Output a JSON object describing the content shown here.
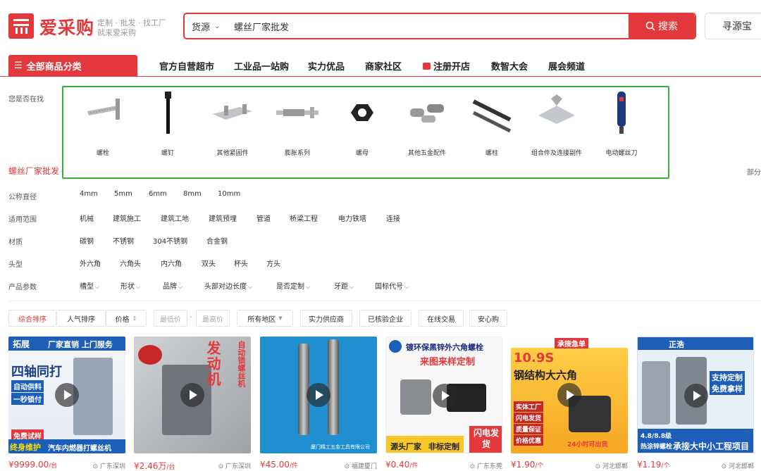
{
  "header": {
    "logo_glyph": "采",
    "logo_text": "爱采购",
    "slogan_line1": "定制 · 批发 · 找工厂",
    "slogan_line2": "就来爱采购",
    "search_category": "货源",
    "search_value": "螺丝厂家批发",
    "search_button": "搜索",
    "find_button": "寻源宝"
  },
  "nav": {
    "all_categories": "全部商品分类",
    "items": [
      "官方自营超市",
      "工业品一站购",
      "实力优品",
      "商家社区",
      "注册开店",
      "数智大会",
      "展会频道"
    ]
  },
  "suggestions": {
    "label": "您是否在找",
    "items": [
      "螺栓",
      "螺钉",
      "其他紧固件",
      "膨胀系列",
      "螺母",
      "其他五金配件",
      "螺柱",
      "组合件及连接副件",
      "电动螺丝刀"
    ]
  },
  "keyword": "螺丝厂家批发",
  "keyword_right": "部分",
  "filters": [
    {
      "label": "公称直径",
      "options": [
        "4mm",
        "5mm",
        "6mm",
        "8mm",
        "10mm"
      ]
    },
    {
      "label": "适用范围",
      "options": [
        "机械",
        "建筑施工",
        "建筑工地",
        "建筑预埋",
        "管道",
        "桥梁工程",
        "电力铁塔",
        "连接"
      ]
    },
    {
      "label": "材质",
      "options": [
        "碳钢",
        "不锈钢",
        "304不锈钢",
        "合金钢"
      ]
    },
    {
      "label": "头型",
      "options": [
        "外六角",
        "六角头",
        "内六角",
        "双头",
        "杯头",
        "方头"
      ]
    },
    {
      "label": "产品参数",
      "options": [
        "槽型",
        "形状",
        "品牌",
        "头部对边长度",
        "是否定制",
        "牙距",
        "国标代号"
      ]
    }
  ],
  "sort": {
    "comprehensive": "综合排序",
    "popularity": "人气排序",
    "price": "价格",
    "min_price": "最低价",
    "dash": "-",
    "max_price": "最高价",
    "region": "所有地区",
    "tags": [
      "实力供应商",
      "已核验企业",
      "在线交易",
      "安心购"
    ]
  },
  "products": [
    {
      "price": "¥9999.00",
      "unit": "/台",
      "location": "广东深圳",
      "overlay": [
        "拓展",
        "厂家直销 上门服务",
        "四轴同打",
        "自动供料",
        "一秒锁付",
        "免费试样",
        "终身维护",
        "汽车内燃器打螺丝机"
      ]
    },
    {
      "price": "¥2.46万",
      "unit": "/台",
      "location": "广东深圳",
      "overlay": [
        "发动机",
        "自动锁螺丝机"
      ]
    },
    {
      "price": "¥45.00",
      "unit": "/件",
      "location": "福建厦门",
      "overlay": [
        "厦门精工五金工具有限公司"
      ]
    },
    {
      "price": "¥0.40",
      "unit": "/件",
      "location": "广东东莞",
      "overlay": [
        "镀环保黑锌外六角螺栓",
        "来图来样定制",
        "源头厂家",
        "非标定制",
        "闪电发货"
      ]
    },
    {
      "price": "¥1.90",
      "unit": "/个",
      "location": "河北邯郸",
      "overlay": [
        "承接急单",
        "10.9S",
        "钢结构大六角",
        "实体工厂",
        "闪电发货",
        "质量保证",
        "价格优惠",
        "24小时可出货"
      ]
    },
    {
      "price": "¥1.19",
      "unit": "/个",
      "location": "河北邯郸",
      "overlay": [
        "正浩",
        "支持定制",
        "免费拿样",
        "4.8/8.8级",
        "热涂锌螺栓",
        "承接大中小工程项目"
      ]
    }
  ]
}
